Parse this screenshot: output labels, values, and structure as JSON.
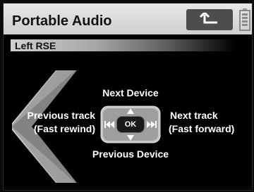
{
  "header": {
    "title": "Portable Audio",
    "back_icon": "back-arrow-icon",
    "battery_icon": "battery-icon"
  },
  "subheader": {
    "label": "Left RSE"
  },
  "controls": {
    "up_label": "Next Device",
    "down_label": "Previous Device",
    "left_label_line1": "Previous track",
    "left_label_line2": "(Fast rewind)",
    "right_label_line1": "Next track",
    "right_label_line2": "(Fast forward)",
    "ok_label": "OK"
  },
  "colors": {
    "title_bar": "#d9d9d9",
    "background": "#000000",
    "label_text": "#ffffff"
  }
}
